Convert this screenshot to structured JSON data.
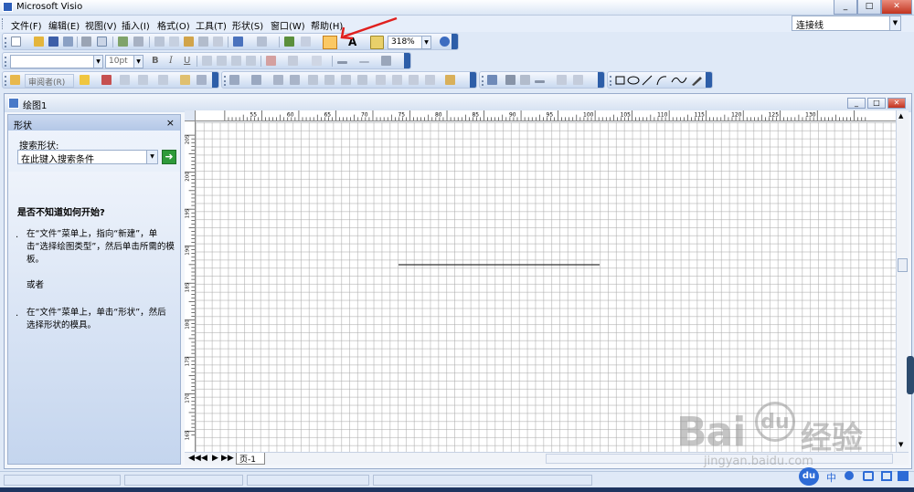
{
  "app": {
    "title": "Microsoft Visio"
  },
  "window_controls": {
    "minimize": "_",
    "restore": "□",
    "close": "✕"
  },
  "menu": [
    "文件(F)",
    "编辑(E)",
    "视图(V)",
    "插入(I)",
    "格式(O)",
    "工具(T)",
    "形状(S)",
    "窗口(W)",
    "帮助(H)"
  ],
  "shape_box": {
    "value": "连接线"
  },
  "toolbar": {
    "zoom": "318%",
    "font_name": "",
    "font_size": "10pt",
    "review_label": "审阅者(R)",
    "bold": "B",
    "italic": "I",
    "underline": "U",
    "text_tool": "A"
  },
  "document": {
    "title": "绘图1"
  },
  "shapes_panel": {
    "title": "形状",
    "close": "×",
    "search_label": "搜索形状:",
    "search_placeholder": "在此键入搜索条件",
    "go": "➜",
    "help_heading": "是否不知道如何开始?",
    "tip1": "在“文件”菜单上，指向“新建”，单击“选择绘图类型”，然后单击所需的模板。",
    "or": "或者",
    "tip2": "在“文件”菜单上，单击“形状”，然后选择形状的模具。"
  },
  "ruler": {
    "top_labels": [
      "55",
      "60",
      "65",
      "70",
      "75",
      "80",
      "85",
      "90",
      "95",
      "100",
      "105",
      "110",
      "115",
      "120",
      "125",
      "130"
    ],
    "left_labels": [
      "205",
      "200",
      "195",
      "190",
      "185",
      "180",
      "175",
      "170",
      "165"
    ]
  },
  "page_tabs": {
    "nav": [
      "◀◀",
      "◀",
      "▶",
      "▶▶"
    ],
    "current": "页-1"
  },
  "colors": {
    "accent": "#2d5ea8",
    "highlight_tool": "#fbc864",
    "annotation_arrow": "#e0201e"
  },
  "watermark": {
    "brand": "Bai",
    "du": "du",
    "cn": "经验",
    "url": "jingyan.baidu.com"
  },
  "tray": {
    "du": "du",
    "lang": "中"
  }
}
